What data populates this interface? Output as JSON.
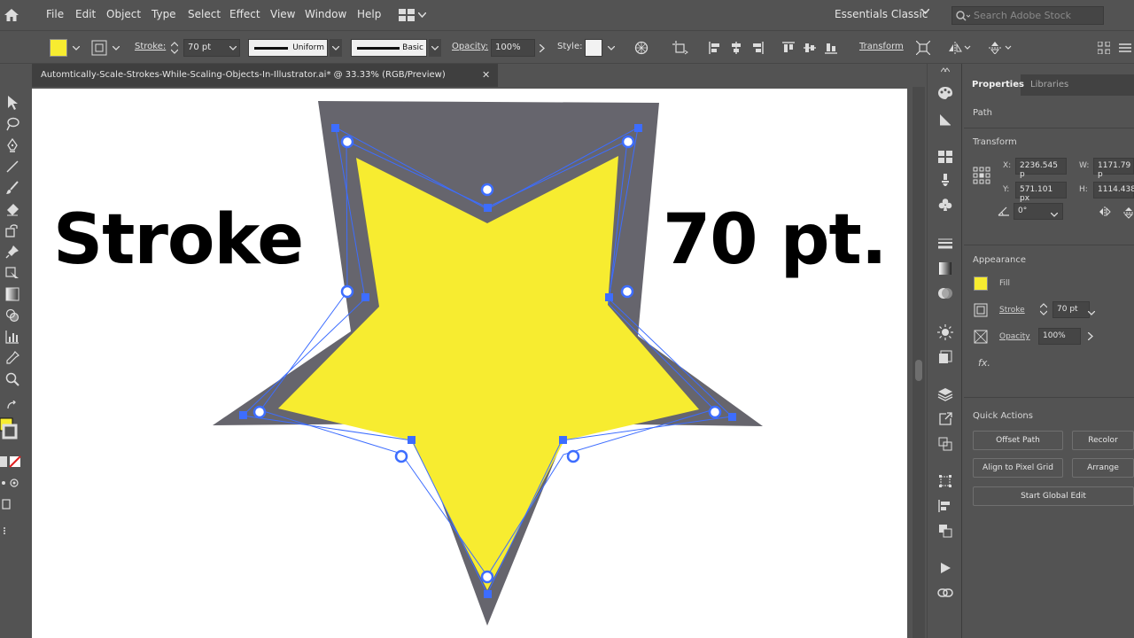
{
  "menubar": {
    "items": [
      "File",
      "Edit",
      "Object",
      "Type",
      "Select",
      "Effect",
      "View",
      "Window",
      "Help"
    ],
    "workspace": "Essentials Classic",
    "search_placeholder": "Search Adobe Stock"
  },
  "controlbar": {
    "stroke_label": "Stroke:",
    "stroke_weight": "70 pt",
    "profile": "Uniform",
    "brush": "Basic",
    "opacity_label": "Opacity:",
    "opacity_value": "100%",
    "style_label": "Style:",
    "transform_link": "Transform"
  },
  "document": {
    "tab_title": "Automtically-Scale-Strokes-While-Scaling-Objects-In-Illustrator.ai* @ 33.33% (RGB/Preview)",
    "close": "✕"
  },
  "artwork": {
    "left_text": "Stroke",
    "right_text": "70 pt.",
    "fill_color": "#f7ec30",
    "stroke_color": "#66656d",
    "path_color": "#3d6dff"
  },
  "properties": {
    "tabs": [
      "Properties",
      "Libraries"
    ],
    "selection_type": "Path",
    "transform": {
      "section": "Transform",
      "x_label": "X:",
      "x": "2236.545 p",
      "y_label": "Y:",
      "y": "571.101 px",
      "w_label": "W:",
      "w": "1171.79 p",
      "h_label": "H:",
      "h": "1114.438",
      "angle": "0°"
    },
    "appearance": {
      "section": "Appearance",
      "fill_label": "Fill",
      "stroke_label": "Stroke",
      "stroke_value": "70 pt",
      "opacity_label": "Opacity",
      "opacity_value": "100%",
      "fx": "fx."
    },
    "quick_actions": {
      "section": "Quick Actions",
      "offset_path": "Offset Path",
      "recolor": "Recolor",
      "align_pixel": "Align to Pixel Grid",
      "arrange": "Arrange",
      "global_edit": "Start Global Edit"
    }
  }
}
